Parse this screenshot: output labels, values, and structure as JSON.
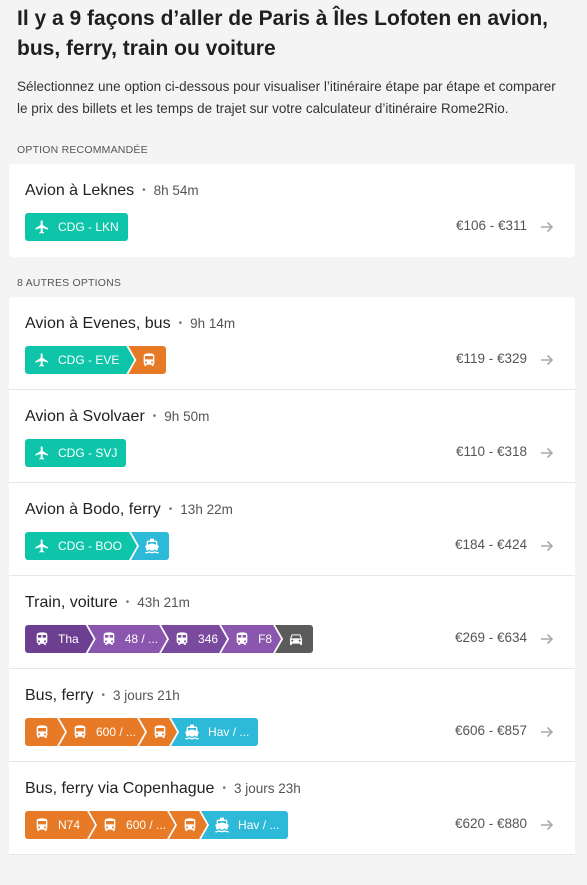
{
  "heading": "Il y a 9 façons d’aller de Paris à Îles Lofoten en avion, bus, ferry, train ou voiture",
  "intro": "Sélectionnez une option ci-dessous pour visualiser l’itinéraire étape par étape et comparer le prix des billets et les temps de trajet sur votre calculateur d’itinéraire Rome2Rio.",
  "recommended_label": "OPTION RECOMMANDÉE",
  "others_label": "8 AUTRES OPTIONS",
  "colors": {
    "air": "#0ec5aa",
    "bus": "#e67a26",
    "ferry": "#2db9d8",
    "train": "#7a4a9e",
    "car": "#5b5b5b"
  },
  "recommended": {
    "title": "Avion à Leknes",
    "duration": "8h 54m",
    "price": "€106 - €311",
    "segments": [
      {
        "mode": "plane-icon",
        "label": "CDG - LKN"
      }
    ]
  },
  "options": [
    {
      "title": "Avion à Evenes, bus",
      "duration": "9h 14m",
      "price": "€119 - €329",
      "segments": [
        {
          "mode": "plane-icon",
          "label": "CDG - EVE"
        },
        {
          "mode": "bus-icon",
          "label": ""
        }
      ]
    },
    {
      "title": "Avion à Svolvaer",
      "duration": "9h 50m",
      "price": "€110 - €318",
      "segments": [
        {
          "mode": "plane-icon",
          "label": "CDG - SVJ"
        }
      ]
    },
    {
      "title": "Avion à Bodo, ferry",
      "duration": "13h 22m",
      "price": "€184 - €424",
      "segments": [
        {
          "mode": "plane-icon",
          "label": "CDG - BOO"
        },
        {
          "mode": "ferry-icon",
          "label": ""
        }
      ]
    },
    {
      "title": "Train, voiture",
      "duration": "43h 21m",
      "price": "€269 - €634",
      "segments": [
        {
          "mode": "train-icon",
          "label": "Tha"
        },
        {
          "mode": "train-icon",
          "label": "48 / ..."
        },
        {
          "mode": "train-icon",
          "label": "346"
        },
        {
          "mode": "train-icon",
          "label": "F8"
        },
        {
          "mode": "car-icon",
          "label": ""
        }
      ]
    },
    {
      "title": "Bus, ferry",
      "duration": "3 jours 21h",
      "price": "€606 - €857",
      "segments": [
        {
          "mode": "bus-icon",
          "label": ""
        },
        {
          "mode": "bus-icon",
          "label": "600 / ..."
        },
        {
          "mode": "bus-icon",
          "label": ""
        },
        {
          "mode": "ferry-icon",
          "label": "Hav / ..."
        }
      ]
    },
    {
      "title": "Bus, ferry via Copenhague",
      "duration": "3 jours 23h",
      "price": "€620 - €880",
      "segments": [
        {
          "mode": "bus-icon",
          "label": "N74"
        },
        {
          "mode": "bus-icon",
          "label": "600 / ..."
        },
        {
          "mode": "bus-icon",
          "label": ""
        },
        {
          "mode": "ferry-icon",
          "label": "Hav / ..."
        }
      ]
    }
  ]
}
